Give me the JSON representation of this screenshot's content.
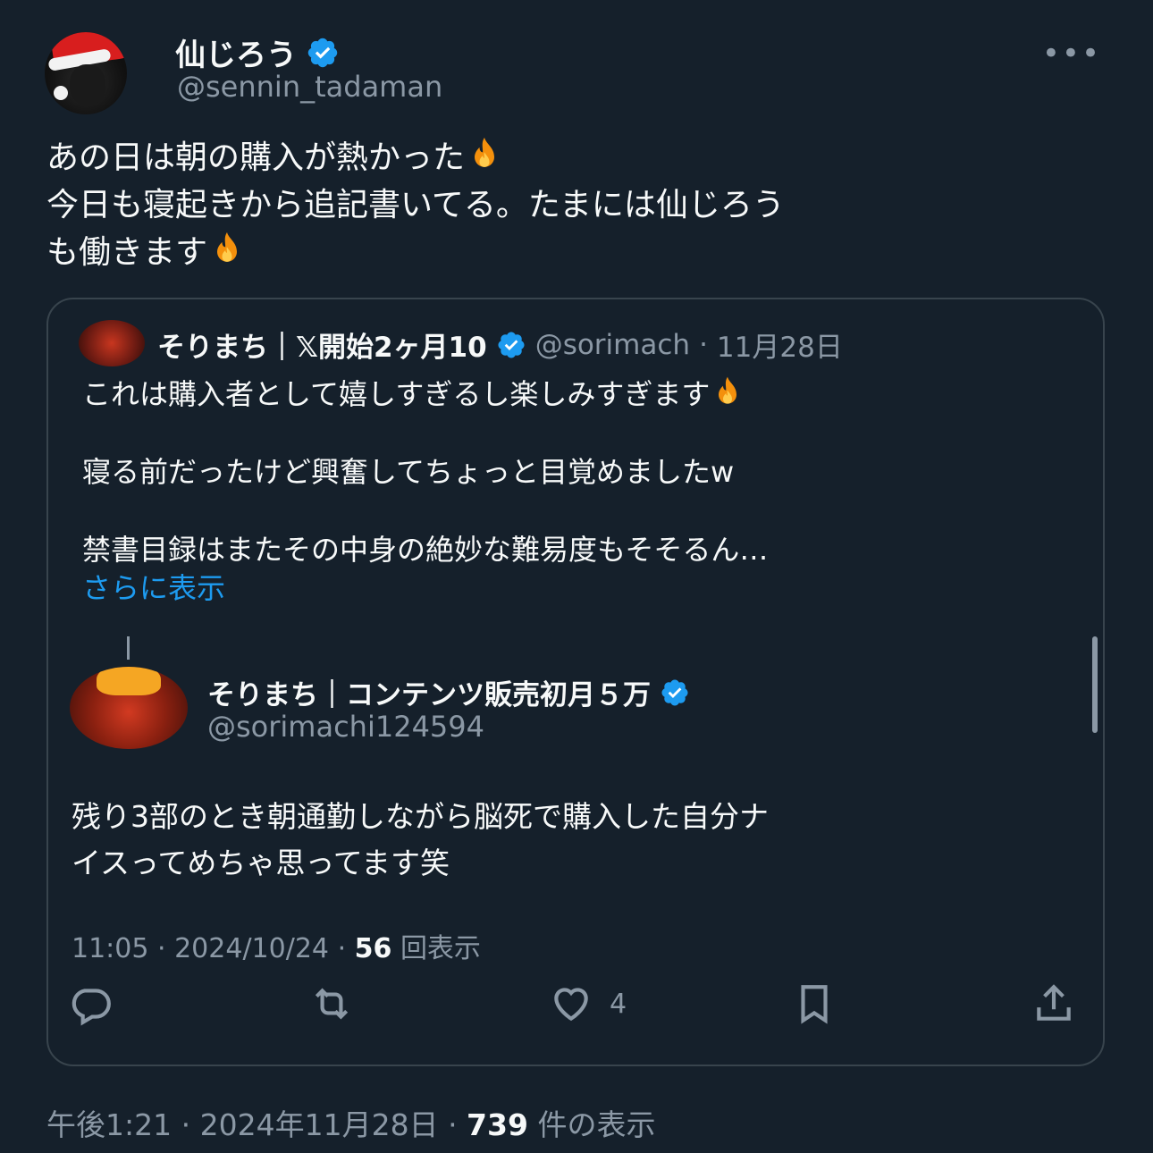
{
  "author": {
    "display_name": "仙じろう",
    "handle": "@sennin_tadaman"
  },
  "tweet": {
    "lines": [
      "あの日は朝の購入が熱かった",
      "今日も寝起きから追記書いてる。たまには仙じろう",
      "も働きます"
    ]
  },
  "quote": {
    "display_name": "そりまち｜𝕏開始2ヶ月10",
    "handle": "@sorimach",
    "date": "11月28日",
    "text": {
      "line1": "これは購入者として嬉しすぎるし楽しみすぎます",
      "line2": "寝る前だったけど興奮してちょっと目覚めましたw",
      "line3": "禁書目録はまたその中身の絶妙な難易度もそそるん…",
      "show_more": "さらに表示"
    },
    "inner": {
      "display_name": "そりまち｜コンテンツ販売初月５万",
      "handle": "@sorimachi124594",
      "text_line1": "残り3部のとき朝通勤しながら脳死で購入した自分ナ",
      "text_line2": "イスってめちゃ思ってます笑",
      "time": "11:05",
      "date": "2024/10/24",
      "views_count": "56",
      "views_label": "回表示",
      "like_count": "4"
    }
  },
  "footer": {
    "time": "午後1:21",
    "date": "2024年11月28日",
    "views_count": "739",
    "views_label": "件の表示"
  },
  "colors": {
    "background": "#15202b",
    "text": "#f7f9f9",
    "secondary": "#8b98a5",
    "link": "#1d9bf0",
    "verified": "#1d9bf0",
    "border": "#38444d"
  },
  "icons": [
    "more-icon",
    "verified-badge-icon",
    "fire-emoji-icon",
    "reply-icon",
    "retweet-icon",
    "like-icon",
    "bookmark-icon",
    "share-icon"
  ]
}
